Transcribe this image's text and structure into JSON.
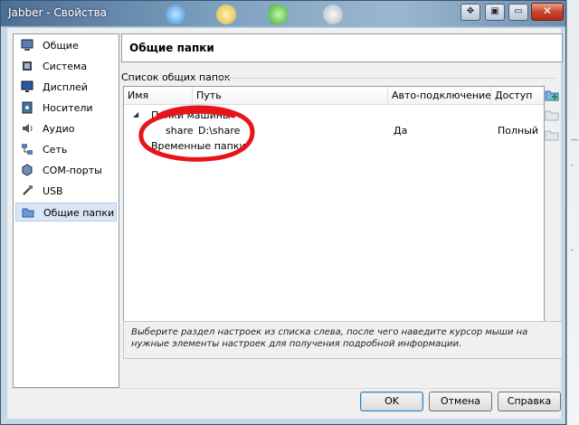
{
  "window": {
    "title": "Jabber - Свойства"
  },
  "sidebar": {
    "items": [
      {
        "label": "Общие",
        "icon": "general-icon"
      },
      {
        "label": "Система",
        "icon": "system-icon"
      },
      {
        "label": "Дисплей",
        "icon": "display-icon"
      },
      {
        "label": "Носители",
        "icon": "storage-icon"
      },
      {
        "label": "Аудио",
        "icon": "audio-icon"
      },
      {
        "label": "Сеть",
        "icon": "network-icon"
      },
      {
        "label": "COM-порты",
        "icon": "serial-ports-icon"
      },
      {
        "label": "USB",
        "icon": "usb-icon"
      },
      {
        "label": "Общие папки",
        "icon": "shared-folders-icon"
      }
    ],
    "selected_index": 8
  },
  "section": {
    "title": "Общие папки",
    "list_label": "Список общих папок"
  },
  "table": {
    "columns": [
      "Имя",
      "Путь",
      "Авто-подключение",
      "Доступ"
    ],
    "groups": [
      {
        "label": "Папки машины",
        "expanded": true,
        "rows": [
          {
            "name": "share",
            "path": "D:\\share",
            "auto_mount": "Да",
            "access": "Полный"
          }
        ]
      },
      {
        "label": "Временные папки",
        "expanded": false,
        "rows": []
      }
    ]
  },
  "info_text": "Выберите раздел настроек из списка слева, после чего наведите курсор мыши на нужные элементы настроек для получения подробной информации.",
  "buttons": {
    "ok": "OK",
    "cancel": "Отмена",
    "help": "Справка"
  },
  "colors": {
    "selection": "#d8e6f5",
    "annotation": "#e8141b",
    "title_bar": "#5d7fa3",
    "close_button": "#c9462e"
  }
}
